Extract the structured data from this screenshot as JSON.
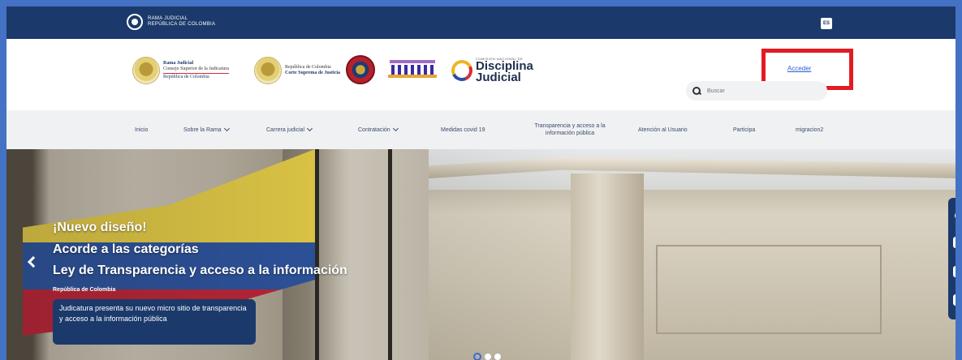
{
  "topbar": {
    "gov_line1": "Rama Judicial",
    "gov_line2": "República de Colombia",
    "lang_label": "ES"
  },
  "header": {
    "logo1": {
      "line1": "Rama Judicial",
      "line2": "Consejo Superior de la Judicatura",
      "line3": "República de Colombia"
    },
    "logo2": {
      "line1": "República de Colombia",
      "line2": "Corte Suprema de Justicia"
    },
    "disciplina": {
      "small": "Comisión Nacional de",
      "line1": "Disciplina",
      "line2": "Judicial"
    },
    "acceder_label": "Acceder",
    "search_placeholder": "Buscar"
  },
  "nav": {
    "items": [
      {
        "label": "Inicio",
        "dropdown": false
      },
      {
        "label": "Sobre la Rama",
        "dropdown": true
      },
      {
        "label": "Carrera judicial",
        "dropdown": true
      },
      {
        "label": "Contratación",
        "dropdown": true
      },
      {
        "label": "Medidas covid 19",
        "dropdown": false
      },
      {
        "label": "Transparencia y acceso a la información pública",
        "dropdown": false
      },
      {
        "label": "Atención al Usuario",
        "dropdown": false
      },
      {
        "label": "Participa",
        "dropdown": false
      },
      {
        "label": "migracion2",
        "dropdown": false
      }
    ]
  },
  "hero": {
    "line1": "¡Nuevo diseño!",
    "line2": "Acorde a las categorías",
    "line3": "Ley de Transparencia y acceso a la información",
    "small": "República de Colombia",
    "card_text": "Judicatura presenta su nuevo micro sitio de transparencia y acceso a la información pública",
    "slides": 3,
    "active_slide": 1
  },
  "a11y": {
    "contrast_icon": "contrast-icon",
    "font_decrease": "A",
    "font_increase": "A",
    "relief_icon": "centro-relevo-icon"
  },
  "colors": {
    "primary": "#1b3a6b",
    "highlight": "#e31b23",
    "link": "#2b5fd0",
    "frame": "#4472c4"
  }
}
